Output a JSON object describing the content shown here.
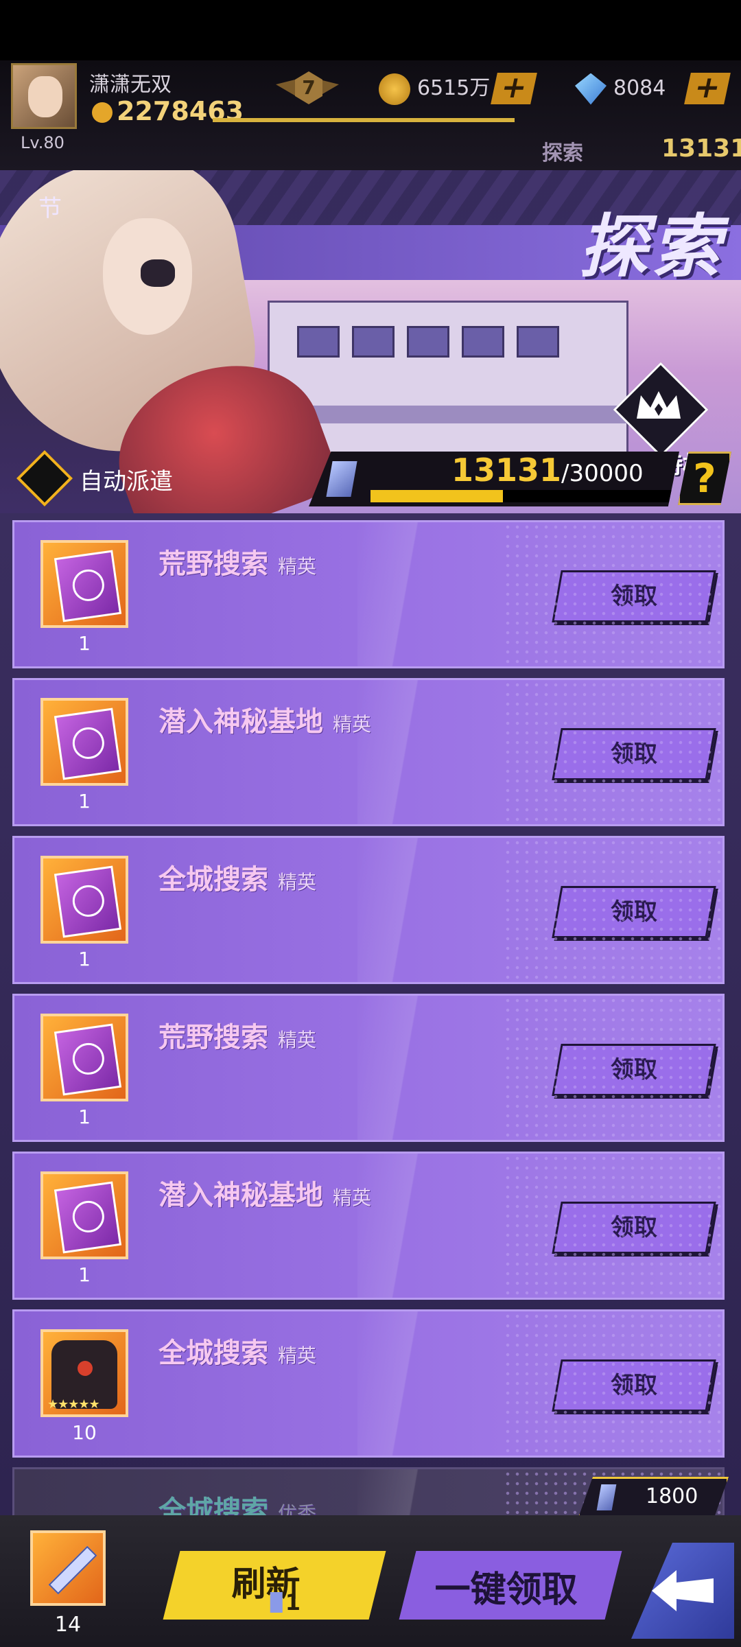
{
  "player": {
    "name": "潇潇无双",
    "power": "2278463",
    "level": "Lv.80",
    "rank": "7",
    "gold": "6515万",
    "gems": "8084",
    "plus_gold": "+",
    "plus_gems": "+"
  },
  "header": {
    "explore_label": "探索",
    "explore_value": "13131",
    "section_tag": "节",
    "title": "探索"
  },
  "hero_panel": {
    "privilege_label": "探索特权",
    "auto_dispatch_label": "自动派遣",
    "progress_current": "13131",
    "progress_max": "/30000",
    "progress_fraction": 0.4377,
    "help": "?"
  },
  "missions": [
    {
      "title": "荒野搜索",
      "tier": "精英",
      "item": "book-icon",
      "qty": "1",
      "claim": "领取"
    },
    {
      "title": "潜入神秘基地",
      "tier": "精英",
      "item": "book-icon",
      "qty": "1",
      "claim": "领取"
    },
    {
      "title": "全城搜索",
      "tier": "精英",
      "item": "book-icon",
      "qty": "1",
      "claim": "领取"
    },
    {
      "title": "荒野搜索",
      "tier": "精英",
      "item": "book-icon",
      "qty": "1",
      "claim": "领取"
    },
    {
      "title": "潜入神秘基地",
      "tier": "精英",
      "item": "book-icon",
      "qty": "1",
      "claim": "领取"
    },
    {
      "title": "全城搜索",
      "tier": "精英",
      "item": "robot-fragment-icon",
      "qty": "10",
      "stars": "★★★★★",
      "claim": "领取"
    },
    {
      "title": "全城搜索",
      "tier": "优秀",
      "cost": "1800"
    }
  ],
  "bottom": {
    "inventory_qty": "14",
    "refresh_label": "刷新",
    "refresh_cost": "1",
    "claim_all_label": "一键领取"
  },
  "colors": {
    "accent_purple": "#8a62d6",
    "accent_yellow": "#f4d22a",
    "gold_text": "#f6c936"
  }
}
